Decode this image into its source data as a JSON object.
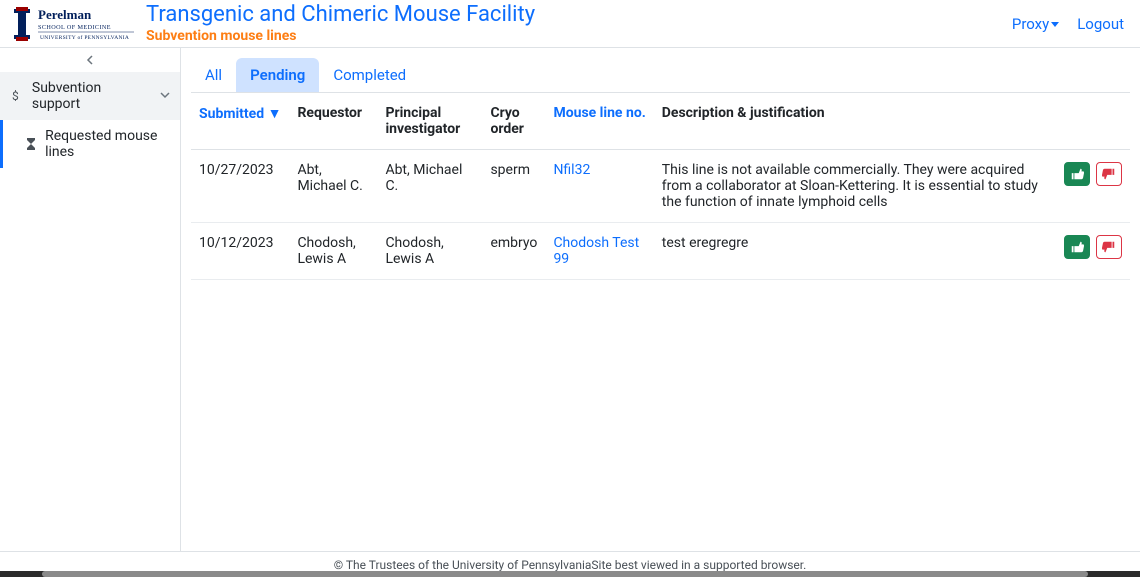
{
  "header": {
    "title": "Transgenic and Chimeric Mouse Facility",
    "subtitle": "Subvention mouse lines",
    "proxy_label": "Proxy",
    "logout_label": "Logout"
  },
  "sidebar": {
    "parent": {
      "label": "Subvention support"
    },
    "child": {
      "label": "Requested mouse lines"
    }
  },
  "tabs": {
    "all": "All",
    "pending": "Pending",
    "completed": "Completed"
  },
  "columns": {
    "submitted": "Submitted",
    "sort_indicator": "▼",
    "requestor": "Requestor",
    "pi": "Principal investigator",
    "cryo": "Cryo order",
    "line": "Mouse line no.",
    "desc": "Description & justification"
  },
  "rows": [
    {
      "submitted": "10/27/2023",
      "requestor": "Abt, Michael C.",
      "pi": "Abt, Michael C.",
      "cryo": "sperm",
      "line": "Nfil32",
      "desc": "This line is not available commercially. They were acquired from a collaborator at Sloan-Kettering. It is essential to study the function of innate lymphoid cells"
    },
    {
      "submitted": "10/12/2023",
      "requestor": "Chodosh, Lewis A",
      "pi": "Chodosh, Lewis A",
      "cryo": "embryo",
      "line": "Chodosh Test 99",
      "desc": "test eregregre"
    }
  ],
  "footer": {
    "text": "© The Trustees of the University of PennsylvaniaSite best viewed in a supported browser."
  }
}
